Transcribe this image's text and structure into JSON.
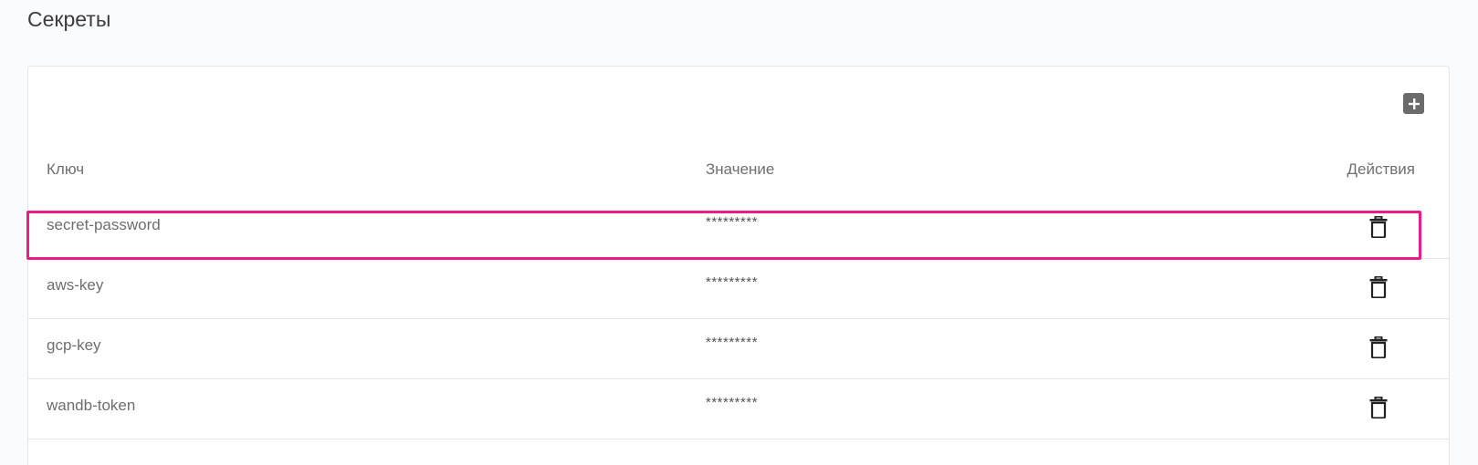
{
  "page": {
    "title": "Секреты"
  },
  "toolbar": {
    "add_icon": "plus-icon"
  },
  "table": {
    "headers": {
      "key": "Ключ",
      "value": "Значение",
      "actions": "Действия"
    },
    "rows": [
      {
        "key": "secret-password",
        "value": "*********",
        "action_icon": "trash-icon"
      },
      {
        "key": "aws-key",
        "value": "*********",
        "action_icon": "trash-icon"
      },
      {
        "key": "gcp-key",
        "value": "*********",
        "action_icon": "trash-icon"
      },
      {
        "key": "wandb-token",
        "value": "*********",
        "action_icon": "trash-icon"
      }
    ]
  },
  "colors": {
    "highlight": "#ec1c86",
    "add_button_bg": "#6b6b6b"
  }
}
